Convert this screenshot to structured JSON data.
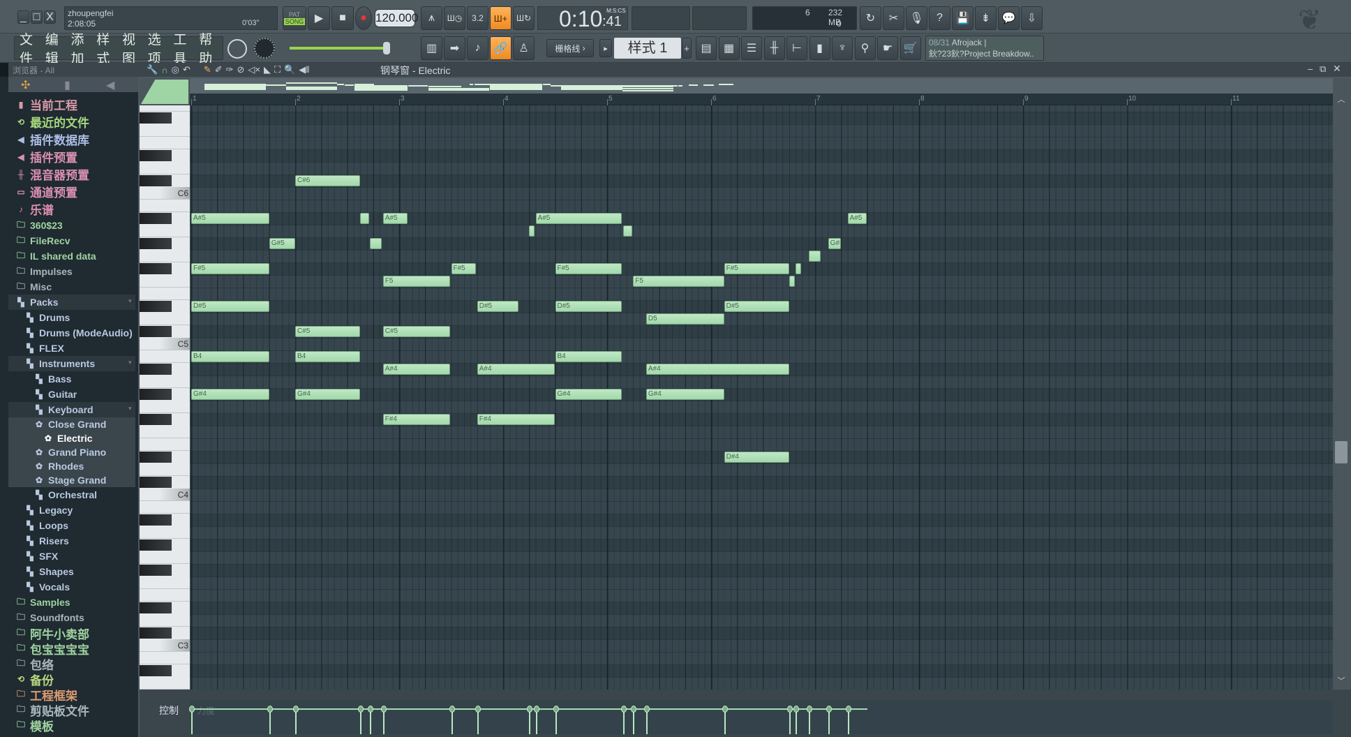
{
  "window": {
    "min": "_",
    "max": "□",
    "close": "X"
  },
  "hint": {
    "user": "zhoupengfei",
    "time": "2:08:05",
    "elapsed": "0'03\""
  },
  "transport": {
    "pat": "PAT",
    "song": "SONG",
    "play_icon": "play-icon",
    "stop_icon": "stop-icon",
    "record_icon": "record-icon",
    "tempo": "120.000"
  },
  "time_display": {
    "value": "0:10",
    "cs": ":41",
    "unit": "M:S:CS"
  },
  "monitor": {
    "cpu": "6",
    "memory": "232 MB",
    "polyphony": "0"
  },
  "menu": [
    "文件",
    "编辑",
    "添加",
    "样式",
    "视图",
    "选项",
    "工具",
    "帮助"
  ],
  "snap": {
    "label": "栅格线"
  },
  "pattern": {
    "label": "样式 1",
    "add": "+"
  },
  "news": {
    "date": "08/31",
    "artist": "Afrojack |",
    "title": "鈥?23鈥?Project Breakdow.."
  },
  "browser": {
    "title": "浏览器 - All",
    "items": [
      {
        "label": "当前工程",
        "icon": "project-icon",
        "glyph": "▮",
        "color": "#d99aa8",
        "kind": "cn"
      },
      {
        "label": "最近的文件",
        "icon": "recent-folder-icon",
        "glyph": "⟲",
        "color": "#a6d67e",
        "kind": "cn"
      },
      {
        "label": "插件数据库",
        "icon": "plugin-database-icon",
        "glyph": "◀",
        "color": "#aebde6",
        "kind": "cn"
      },
      {
        "label": "插件预置",
        "icon": "plugin-preset-icon",
        "glyph": "◀",
        "color": "#d88fb0",
        "kind": "cn"
      },
      {
        "label": "混音器预置",
        "icon": "mixer-preset-icon",
        "glyph": "╫",
        "color": "#d88fb0",
        "kind": "cn"
      },
      {
        "label": "通道预置",
        "icon": "channel-preset-icon",
        "glyph": "▭",
        "color": "#d88fb0",
        "kind": "cn"
      },
      {
        "label": "乐谱",
        "icon": "score-icon",
        "glyph": "♪",
        "color": "#d88fb0",
        "kind": "cn"
      },
      {
        "label": "360$23",
        "icon": "folder-icon",
        "glyph": "🗀",
        "color": "#9fd3a0",
        "kind": "en"
      },
      {
        "label": "FileRecv",
        "icon": "folder-icon",
        "glyph": "🗀",
        "color": "#9fd3a0",
        "kind": "en"
      },
      {
        "label": "IL shared data",
        "icon": "folder-icon",
        "glyph": "🗀",
        "color": "#9fd3a0",
        "kind": "en"
      },
      {
        "label": "Impulses",
        "icon": "folder-icon",
        "glyph": "🗀",
        "color": "#a9b6be",
        "kind": "en"
      },
      {
        "label": "Misc",
        "icon": "folder-icon",
        "glyph": "🗀",
        "color": "#a9b6be",
        "kind": "en"
      },
      {
        "label": "Packs",
        "icon": "pack-icon",
        "glyph": "▚",
        "color": "#b9c9e0",
        "kind": "en",
        "depth": 0,
        "expanded": true
      },
      {
        "label": "Drums",
        "icon": "pack-icon",
        "glyph": "▚",
        "color": "#b9c9e0",
        "kind": "en",
        "depth": 1
      },
      {
        "label": "Drums (ModeAudio)",
        "icon": "pack-icon",
        "glyph": "▚",
        "color": "#b9c9e0",
        "kind": "en",
        "depth": 1
      },
      {
        "label": "FLEX",
        "icon": "pack-icon",
        "glyph": "▚",
        "color": "#b9c9e0",
        "kind": "en",
        "depth": 1
      },
      {
        "label": "Instruments",
        "icon": "pack-icon",
        "glyph": "▚",
        "color": "#b9c9e0",
        "kind": "en",
        "depth": 1,
        "expanded": true
      },
      {
        "label": "Bass",
        "icon": "pack-icon",
        "glyph": "▚",
        "color": "#b9c9e0",
        "kind": "en",
        "depth": 2
      },
      {
        "label": "Guitar",
        "icon": "pack-icon",
        "glyph": "▚",
        "color": "#b9c9e0",
        "kind": "en",
        "depth": 2
      },
      {
        "label": "Keyboard",
        "icon": "pack-icon",
        "glyph": "▚",
        "color": "#b9c9e0",
        "kind": "en",
        "depth": 2,
        "expanded": true
      },
      {
        "label": "Close Grand",
        "icon": "preset-icon",
        "glyph": "✿",
        "color": "#b9c9e0",
        "kind": "preset",
        "depth": 2
      },
      {
        "label": "Electric",
        "icon": "preset-icon",
        "glyph": "✿",
        "color": "#ffffff",
        "kind": "preset",
        "depth": 3,
        "selected": true
      },
      {
        "label": "Grand Piano",
        "icon": "preset-icon",
        "glyph": "✿",
        "color": "#b9c9e0",
        "kind": "preset",
        "depth": 2
      },
      {
        "label": "Rhodes",
        "icon": "preset-icon",
        "glyph": "✿",
        "color": "#b9c9e0",
        "kind": "preset",
        "depth": 2
      },
      {
        "label": "Stage Grand",
        "icon": "preset-icon",
        "glyph": "✿",
        "color": "#b9c9e0",
        "kind": "preset",
        "depth": 2
      },
      {
        "label": "Orchestral",
        "icon": "pack-icon",
        "glyph": "▚",
        "color": "#b9c9e0",
        "kind": "en",
        "depth": 2
      },
      {
        "label": "Legacy",
        "icon": "pack-icon",
        "glyph": "▚",
        "color": "#b9c9e0",
        "kind": "en",
        "depth": 1
      },
      {
        "label": "Loops",
        "icon": "pack-icon",
        "glyph": "▚",
        "color": "#b9c9e0",
        "kind": "en",
        "depth": 1
      },
      {
        "label": "Risers",
        "icon": "pack-icon",
        "glyph": "▚",
        "color": "#b9c9e0",
        "kind": "en",
        "depth": 1
      },
      {
        "label": "SFX",
        "icon": "pack-icon",
        "glyph": "▚",
        "color": "#b9c9e0",
        "kind": "en",
        "depth": 1
      },
      {
        "label": "Shapes",
        "icon": "pack-icon",
        "glyph": "▚",
        "color": "#b9c9e0",
        "kind": "en",
        "depth": 1
      },
      {
        "label": "Vocals",
        "icon": "pack-icon",
        "glyph": "▚",
        "color": "#b9c9e0",
        "kind": "en",
        "depth": 1
      },
      {
        "label": "Samples",
        "icon": "folder-icon",
        "glyph": "🗀",
        "color": "#9fd3a0",
        "kind": "en"
      },
      {
        "label": "Soundfonts",
        "icon": "folder-icon",
        "glyph": "🗀",
        "color": "#a9b6be",
        "kind": "en"
      },
      {
        "label": "阿牛小卖部",
        "icon": "folder-icon",
        "glyph": "🗀",
        "color": "#9fd3a0",
        "kind": "cn2"
      },
      {
        "label": "包宝宝宝宝",
        "icon": "folder-icon",
        "glyph": "🗀",
        "color": "#9fd3a0",
        "kind": "cn2"
      },
      {
        "label": "包络",
        "icon": "folder-icon",
        "glyph": "🗀",
        "color": "#a9b6be",
        "kind": "cn2"
      },
      {
        "label": "备份",
        "icon": "recent-folder-icon",
        "glyph": "⟲",
        "color": "#b8d67e",
        "kind": "cn2"
      },
      {
        "label": "工程框架",
        "icon": "folder-icon",
        "glyph": "🗀",
        "color": "#dd9d72",
        "kind": "cn2"
      },
      {
        "label": "剪贴板文件",
        "icon": "folder-icon",
        "glyph": "🗀",
        "color": "#a9b6be",
        "kind": "cn2"
      },
      {
        "label": "模板",
        "icon": "folder-icon",
        "glyph": "🗀",
        "color": "#9fd3a0",
        "kind": "cn2"
      }
    ]
  },
  "piano_roll": {
    "title": "钢琴窗 - Electric",
    "tools": [
      "wrench-icon",
      "magnet-icon",
      "target-icon",
      "undo-icon",
      "pencil-icon",
      "paint-icon",
      "brush-icon",
      "delete-icon",
      "mute-icon",
      "slice-icon",
      "select-icon",
      "zoom-icon",
      "playback-icon"
    ],
    "bars": [
      "1",
      "2",
      "3",
      "4",
      "5",
      "6",
      "7",
      "8",
      "9",
      "10",
      "11"
    ],
    "control_label": "控制",
    "control_target": "力度",
    "default_velocity": 0.78,
    "note_color": "#a8dcb0",
    "notes": [
      {
        "pitch": "A#5",
        "start_step": 0,
        "length_steps": 12
      },
      {
        "pitch": "F#5",
        "start_step": 0,
        "length_steps": 12
      },
      {
        "pitch": "D#5",
        "start_step": 0,
        "length_steps": 12
      },
      {
        "pitch": "B4",
        "start_step": 0,
        "length_steps": 12
      },
      {
        "pitch": "G#4",
        "start_step": 0,
        "length_steps": 12
      },
      {
        "pitch": "G#5",
        "start_step": 12,
        "length_steps": 4
      },
      {
        "pitch": "C#6",
        "start_step": 16,
        "length_steps": 10
      },
      {
        "pitch": "C#5",
        "start_step": 16,
        "length_steps": 10
      },
      {
        "pitch": "B4",
        "start_step": 16,
        "length_steps": 10
      },
      {
        "pitch": "G#4",
        "start_step": 16,
        "length_steps": 10
      },
      {
        "pitch": "A#5",
        "start_step": 26,
        "length_steps": 1.4
      },
      {
        "pitch": "G#5",
        "start_step": 27.5,
        "length_steps": 1.8
      },
      {
        "pitch": "A#5",
        "start_step": 29.5,
        "length_steps": 3.8
      },
      {
        "pitch": "F5",
        "start_step": 29.5,
        "length_steps": 10.3
      },
      {
        "pitch": "C#5",
        "start_step": 29.5,
        "length_steps": 10.3
      },
      {
        "pitch": "A#4",
        "start_step": 29.5,
        "length_steps": 10.3
      },
      {
        "pitch": "F#4",
        "start_step": 29.5,
        "length_steps": 10.3
      },
      {
        "pitch": "F#5",
        "start_step": 40,
        "length_steps": 3.8
      },
      {
        "pitch": "D#5",
        "start_step": 44,
        "length_steps": 6.4
      },
      {
        "pitch": "A#4",
        "start_step": 44,
        "length_steps": 11.9
      },
      {
        "pitch": "F#4",
        "start_step": 44,
        "length_steps": 11.9
      },
      {
        "pitch": "A5",
        "start_step": 52,
        "length_steps": 0.8
      },
      {
        "pitch": "A#5",
        "start_step": 53,
        "length_steps": 13.3
      },
      {
        "pitch": "F#5",
        "start_step": 56,
        "length_steps": 10.3
      },
      {
        "pitch": "D#5",
        "start_step": 56,
        "length_steps": 10.3
      },
      {
        "pitch": "B4",
        "start_step": 56,
        "length_steps": 10.3
      },
      {
        "pitch": "G#4",
        "start_step": 56,
        "length_steps": 10.3
      },
      {
        "pitch": "A5",
        "start_step": 66.5,
        "length_steps": 1.4
      },
      {
        "pitch": "F5",
        "start_step": 68,
        "length_steps": 14
      },
      {
        "pitch": "D5",
        "start_step": 70,
        "length_steps": 12
      },
      {
        "pitch": "A#4",
        "start_step": 70,
        "length_steps": 22
      },
      {
        "pitch": "G#4",
        "start_step": 70,
        "length_steps": 12
      },
      {
        "pitch": "F#5",
        "start_step": 82,
        "length_steps": 10
      },
      {
        "pitch": "D#5",
        "start_step": 82,
        "length_steps": 10
      },
      {
        "pitch": "D#4",
        "start_step": 82,
        "length_steps": 10
      },
      {
        "pitch": "F5",
        "start_step": 92,
        "length_steps": 0.9
      },
      {
        "pitch": "F#5",
        "start_step": 93,
        "length_steps": 0.9
      },
      {
        "pitch": "G5",
        "start_step": 95,
        "length_steps": 1.9
      },
      {
        "pitch": "G#5",
        "start_step": 98,
        "length_steps": 2
      },
      {
        "pitch": "A#5",
        "start_step": 101,
        "length_steps": 2.9
      }
    ]
  }
}
